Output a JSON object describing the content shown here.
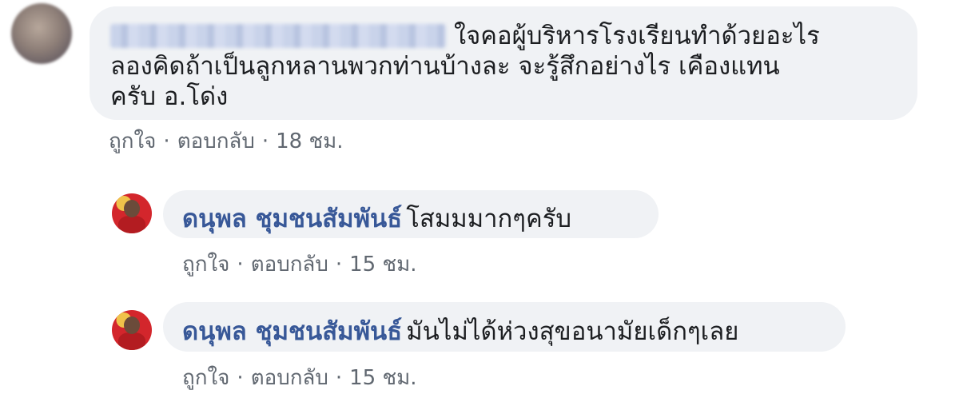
{
  "comment": {
    "text_line1": "ใจคอผู้บริหารโรงเรียนทำด้วยอะไร",
    "text_line2": "ลองคิดถ้าเป็นลูกหลานพวกท่านบ้างละ จะรู้สึกอย่างไร เคืองแทน",
    "text_line3": "ครับ อ.โด่ง",
    "like_label": "ถูกใจ",
    "reply_label": "ตอบกลับ",
    "time": "18 ชม."
  },
  "replies": [
    {
      "author": "ดนุพล ชุมชนสัมพันธ์",
      "text": "โสมมมากๆครับ",
      "like_label": "ถูกใจ",
      "reply_label": "ตอบกลับ",
      "time": "15 ชม."
    },
    {
      "author": "ดนุพล ชุมชนสัมพันธ์",
      "text": "มันไม่ได้ห่วงสุขอนามัยเด็กๆเลย",
      "like_label": "ถูกใจ",
      "reply_label": "ตอบกลับ",
      "time": "15 ชม."
    }
  ],
  "separator": "·",
  "colors": {
    "bubble": "#f0f2f5",
    "author": "#385898",
    "meta": "#606770"
  }
}
